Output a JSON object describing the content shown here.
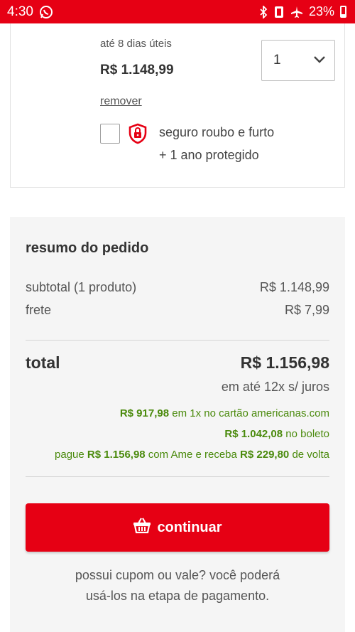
{
  "status_bar": {
    "time": "4:30",
    "battery_percent": "23%",
    "icons": [
      "whatsapp-icon",
      "bluetooth-icon",
      "vibrate-icon",
      "airplane-icon",
      "battery-icon"
    ]
  },
  "product": {
    "delivery": "até 8 dias úteis",
    "price": "R$ 1.148,99",
    "quantity": "1",
    "remove_label": "remover",
    "insurance": {
      "title": "seguro roubo e furto",
      "subtitle": "+ 1 ano protegido",
      "checked": false
    }
  },
  "summary": {
    "heading": "resumo do pedido",
    "subtotal_label": "subtotal (1 produto)",
    "subtotal_value": "R$ 1.148,99",
    "shipping_label": "frete",
    "shipping_value": "R$ 7,99",
    "total_label": "total",
    "total_value": "R$ 1.156,98",
    "installments": "em até 12x s/ juros",
    "promo_card_amount": "R$ 917,98",
    "promo_card_text": " em 1x no cartão americanas.com",
    "promo_boleto_amount": "R$ 1.042,08",
    "promo_boleto_text": " no boleto",
    "promo_ame_prefix": "pague ",
    "promo_ame_amount": "R$ 1.156,98",
    "promo_ame_middle": " com Ame e receba ",
    "promo_ame_cashback": "R$ 229,80",
    "promo_ame_suffix": " de volta",
    "continue_label": "continuar",
    "coupon_line1": "possui cupom ou vale? você poderá",
    "coupon_line2": "usá-los na etapa de pagamento."
  },
  "colors": {
    "brand_red": "#e60014",
    "promo_green": "#4a8a0c",
    "summary_bg": "#f5f5f5"
  }
}
